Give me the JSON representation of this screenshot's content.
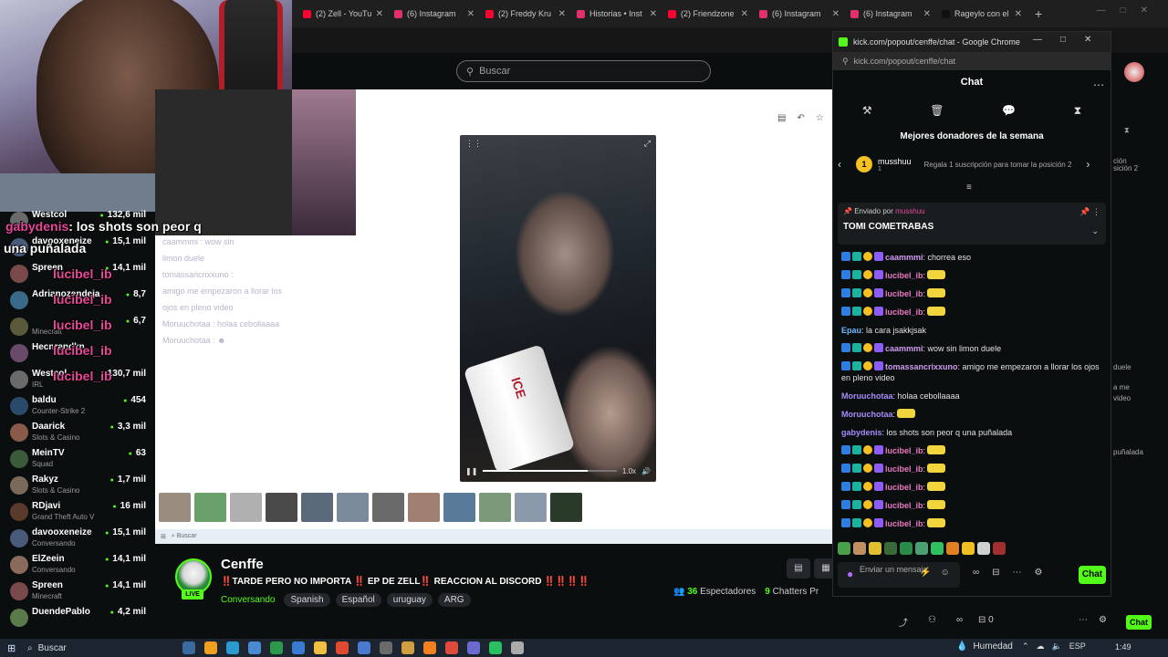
{
  "browser_tabs": [
    {
      "label": "(2) Zell - YouTu",
      "color": "#ff0033"
    },
    {
      "label": "(6) Instagram",
      "color": "#e1306c"
    },
    {
      "label": "(2) Freddy Kru",
      "color": "#ff0033"
    },
    {
      "label": "Historias • Inst",
      "color": "#e1306c"
    },
    {
      "label": "(2) Friendzone",
      "color": "#ff0033"
    },
    {
      "label": "(6) Instagram",
      "color": "#e1306c"
    },
    {
      "label": "(6) Instagram",
      "color": "#e1306c"
    },
    {
      "label": "Rageylo con el",
      "color": "#111111"
    }
  ],
  "search": {
    "placeholder": "Buscar"
  },
  "bigchat": {
    "line1_user": "gabydenis",
    "line1_text": ": los shots son peor q",
    "line2_text": "una puñalada",
    "repeat_user": "lucibel_ib"
  },
  "overlay_ghost": [
    "caammmi : wow sin",
    "limon duele",
    "tomassancrixxuno :",
    "amigo me empezaron a llorar los",
    "ojos en pleno video",
    "Moruuchotaa : holaa cebollaaaa",
    "Moruuchotaa : ☻"
  ],
  "sidebar": {
    "channels": [
      {
        "name": "Westcol",
        "cat": "",
        "viewers": "132,6 mil",
        "color": "#6a6a6a"
      },
      {
        "name": "davooxeneize",
        "cat": "",
        "viewers": "15,1 mil",
        "color": "#4a5a7a"
      },
      {
        "name": "Spreen",
        "cat": "",
        "viewers": "14,1 mil",
        "color": "#7a4a4a"
      },
      {
        "name": "Adrianozendeja",
        "cat": "",
        "viewers": "8,7",
        "color": "#3a6a8a"
      },
      {
        "name": "",
        "cat": "Minecraft",
        "viewers": "6,7",
        "color": "#5a5a3a"
      },
      {
        "name": "Hecnrandkn",
        "cat": "",
        "viewers": "",
        "color": "#6a4a6a"
      },
      {
        "name": "Westcol",
        "cat": "IRL",
        "viewers": "130,7 mil",
        "color": "#6a6a6a"
      },
      {
        "name": "baldu",
        "cat": "Counter-Strike 2",
        "viewers": "454",
        "color": "#2a4a6a"
      },
      {
        "name": "Daarick",
        "cat": "Slots & Casino",
        "viewers": "3,3 mil",
        "color": "#8a5a4a"
      },
      {
        "name": "MeinTV",
        "cat": "Squad",
        "viewers": "63",
        "color": "#3a5a3a"
      },
      {
        "name": "Rakyz",
        "cat": "Slots & Casino",
        "viewers": "1,7 mil",
        "color": "#7a6a5a"
      },
      {
        "name": "RDjavi",
        "cat": "Grand Theft Auto V",
        "viewers": "16 mil",
        "color": "#5a3a2a"
      },
      {
        "name": "davooxeneize",
        "cat": "Conversando",
        "viewers": "15,1 mil",
        "color": "#4a5a7a"
      },
      {
        "name": "ElZeein",
        "cat": "Conversando",
        "viewers": "14,1 mil",
        "color": "#8a6a5a"
      },
      {
        "name": "Spreen",
        "cat": "Minecraft",
        "viewers": "14,1 mil",
        "color": "#7a4a4a"
      },
      {
        "name": "DuendePablo",
        "cat": "",
        "viewers": "4,2 mil",
        "color": "#5a7a4a"
      }
    ]
  },
  "stream": {
    "name": "Cenffe",
    "live": "LIVE",
    "title": "‼️TARDE PERO NO IMPORTA ‼️ EP DE ZELL‼️ REACCION AL DISCORD ‼️‼️‼️‼️",
    "category": "Conversando",
    "tags": [
      "Spanish",
      "Español",
      "uruguay",
      "ARG"
    ],
    "viewers_count": "36",
    "viewers_label": "Espectadores",
    "chatters_count": "9",
    "chatters_label": "Chatters Pr"
  },
  "popout": {
    "window_title": "kick.com/popout/cenffe/chat - Google Chrome",
    "url": "kick.com/popout/cenffe/chat",
    "chat_title": "Chat",
    "donors_title": "Mejores donadores de la semana",
    "donor_rank": "1",
    "donor_name": "musshuu",
    "donor_sub_count": "1",
    "donor_cta": "Regala 1 suscripción para tomar la posición 2",
    "pinned_prefix": "Enviado por",
    "pinned_user": "musshuu",
    "pinned_message": "TOMI COMETRABAS",
    "messages": [
      {
        "user": "caammmi",
        "ucls": "u-lil",
        "text": ": chorrea eso",
        "emote": false
      },
      {
        "user": "lucibel_ib",
        "ucls": "u-pink",
        "text": ":",
        "emote": true
      },
      {
        "user": "lucibel_ib",
        "ucls": "u-pink",
        "text": ":",
        "emote": true
      },
      {
        "user": "lucibel_ib",
        "ucls": "u-pink",
        "text": ":",
        "emote": true
      },
      {
        "user": "Epau",
        "ucls": "u-blue",
        "text": ": la cara jsakkjsak",
        "emote": false
      },
      {
        "user": "caammmi",
        "ucls": "u-lil",
        "text": ": wow sin limon duele",
        "emote": false
      },
      {
        "user": "tomassancrixxuno",
        "ucls": "u-lil",
        "text": ": amigo me empezaron a llorar los ojos en pleno video",
        "emote": false
      },
      {
        "user": "Moruuchotaa",
        "ucls": "u-purple",
        "text": ": holaa cebollaaaa",
        "emote": false
      },
      {
        "user": "Moruuchotaa",
        "ucls": "u-purple",
        "text": ":",
        "emote": true
      },
      {
        "user": "gabydenis",
        "ucls": "u-purple",
        "text": ": los shots son peor q una puñalada",
        "emote": false
      },
      {
        "user": "lucibel_ib",
        "ucls": "u-pink",
        "text": ":",
        "emote": true
      },
      {
        "user": "lucibel_ib",
        "ucls": "u-pink",
        "text": ":",
        "emote": true
      },
      {
        "user": "lucibel_ib",
        "ucls": "u-pink",
        "text": ":",
        "emote": true
      },
      {
        "user": "lucibel_ib",
        "ucls": "u-pink",
        "text": ":",
        "emote": true
      },
      {
        "user": "lucibel_ib",
        "ucls": "u-pink",
        "text": ":",
        "emote": true
      }
    ],
    "input_placeholder": "Enviar un mensaje",
    "chat_button": "Chat"
  },
  "bg_right": {
    "t1": "ción",
    "t2": "sición 2",
    "t3": "duele",
    "t4": "a me",
    "t5": "video",
    "t6": "puñalada"
  },
  "page_bottom": {
    "count": "0",
    "chat_button": "Chat"
  },
  "taskbar": {
    "search_label": "Buscar",
    "weather": "Humedad",
    "lang": "ESP",
    "time": "1:49"
  }
}
